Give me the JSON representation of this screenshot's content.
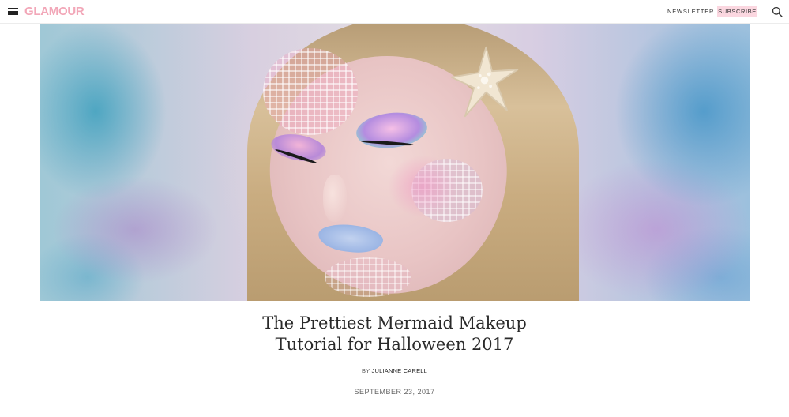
{
  "header": {
    "logo": "GLAMOUR",
    "newsletter_label": "NEWSLETTER",
    "subscribe_label": "SUBSCRIBE",
    "menu_icon": "hamburger-menu-icon",
    "search_icon": "search-icon"
  },
  "colors": {
    "brand_pink": "#f2a7b8",
    "subscribe_bg": "#fbd7e0"
  },
  "article": {
    "title_line1": "The Prettiest Mermaid Makeup",
    "title_line2": "Tutorial for Halloween 2017",
    "byline_prefix": "BY",
    "author": "JULIANNE CARELL",
    "date": "SEPTEMBER 23, 2017"
  }
}
